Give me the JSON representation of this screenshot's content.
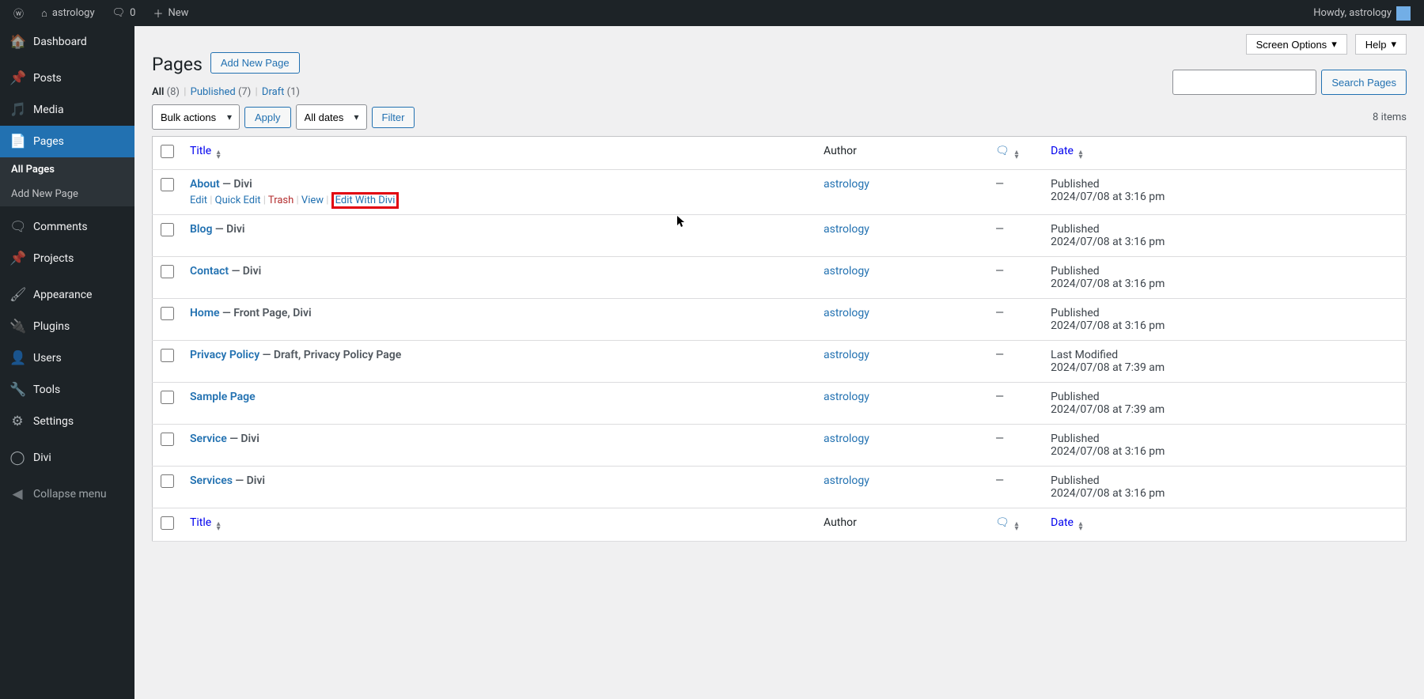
{
  "adminbar": {
    "site_name": "astrology",
    "comments_count": "0",
    "new_label": "New",
    "howdy": "Howdy, astrology"
  },
  "sidebar": {
    "items": [
      {
        "icon": "dashboard",
        "label": "Dashboard"
      },
      {
        "icon": "posts",
        "label": "Posts"
      },
      {
        "icon": "media",
        "label": "Media"
      },
      {
        "icon": "pages",
        "label": "Pages",
        "active": true
      },
      {
        "icon": "comments",
        "label": "Comments"
      },
      {
        "icon": "projects",
        "label": "Projects"
      },
      {
        "icon": "appearance",
        "label": "Appearance"
      },
      {
        "icon": "plugins",
        "label": "Plugins"
      },
      {
        "icon": "users",
        "label": "Users"
      },
      {
        "icon": "tools",
        "label": "Tools"
      },
      {
        "icon": "settings",
        "label": "Settings"
      },
      {
        "icon": "divi",
        "label": "Divi"
      },
      {
        "icon": "collapse",
        "label": "Collapse menu"
      }
    ],
    "submenu": {
      "all_pages": "All Pages",
      "add_new": "Add New Page"
    }
  },
  "header": {
    "screen_options": "Screen Options",
    "help": "Help",
    "title": "Pages",
    "add_new": "Add New Page"
  },
  "filters": {
    "all_label": "All",
    "all_count": "(8)",
    "published_label": "Published",
    "published_count": "(7)",
    "draft_label": "Draft",
    "draft_count": "(1)",
    "bulk_actions": "Bulk actions",
    "apply": "Apply",
    "all_dates": "All dates",
    "filter": "Filter",
    "search": "Search Pages",
    "items_count": "8 items"
  },
  "columns": {
    "title": "Title",
    "author": "Author",
    "date": "Date"
  },
  "row_actions": {
    "edit": "Edit",
    "quick_edit": "Quick Edit",
    "trash": "Trash",
    "view": "View",
    "edit_divi": "Edit With Divi"
  },
  "rows": [
    {
      "title": "About",
      "meta": " — Divi",
      "author": "astrology",
      "comments": "—",
      "status": "Published",
      "date": "2024/07/08 at 3:16 pm",
      "show_actions": true
    },
    {
      "title": "Blog",
      "meta": " — Divi",
      "author": "astrology",
      "comments": "—",
      "status": "Published",
      "date": "2024/07/08 at 3:16 pm"
    },
    {
      "title": "Contact",
      "meta": " — Divi",
      "author": "astrology",
      "comments": "—",
      "status": "Published",
      "date": "2024/07/08 at 3:16 pm"
    },
    {
      "title": "Home",
      "meta": " — Front Page, Divi",
      "author": "astrology",
      "comments": "—",
      "status": "Published",
      "date": "2024/07/08 at 3:16 pm"
    },
    {
      "title": "Privacy Policy",
      "meta": " — Draft, Privacy Policy Page",
      "author": "astrology",
      "comments": "—",
      "status": "Last Modified",
      "date": "2024/07/08 at 7:39 am"
    },
    {
      "title": "Sample Page",
      "meta": "",
      "author": "astrology",
      "comments": "—",
      "status": "Published",
      "date": "2024/07/08 at 7:39 am"
    },
    {
      "title": "Service",
      "meta": " — Divi",
      "author": "astrology",
      "comments": "—",
      "status": "Published",
      "date": "2024/07/08 at 3:16 pm"
    },
    {
      "title": "Services",
      "meta": " — Divi",
      "author": "astrology",
      "comments": "—",
      "status": "Published",
      "date": "2024/07/08 at 3:16 pm"
    }
  ]
}
